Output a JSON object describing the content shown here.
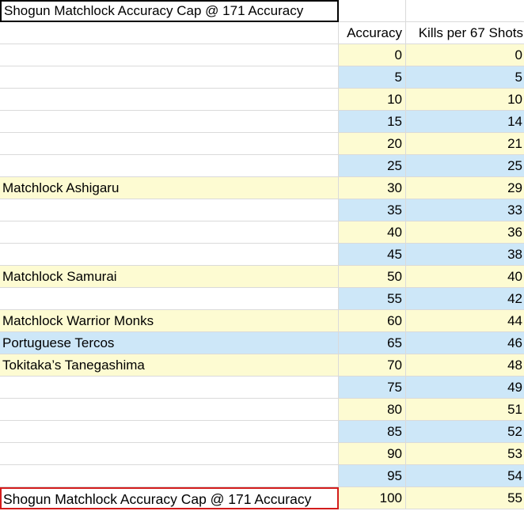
{
  "title": "Shogun Matchlock Accuracy Cap @ 171 Accuracy",
  "headers": {
    "accuracy": "Accuracy",
    "kills": "Kills per 67 Shots"
  },
  "rows": [
    {
      "name": "",
      "accuracy": "0",
      "kills": "0"
    },
    {
      "name": "",
      "accuracy": "5",
      "kills": "5"
    },
    {
      "name": "",
      "accuracy": "10",
      "kills": "10"
    },
    {
      "name": "",
      "accuracy": "15",
      "kills": "14"
    },
    {
      "name": "",
      "accuracy": "20",
      "kills": "21"
    },
    {
      "name": "",
      "accuracy": "25",
      "kills": "25"
    },
    {
      "name": "Matchlock Ashigaru",
      "accuracy": "30",
      "kills": "29"
    },
    {
      "name": "",
      "accuracy": "35",
      "kills": "33"
    },
    {
      "name": "",
      "accuracy": "40",
      "kills": "36"
    },
    {
      "name": "",
      "accuracy": "45",
      "kills": "38"
    },
    {
      "name": "Matchlock Samurai",
      "accuracy": "50",
      "kills": "40"
    },
    {
      "name": "",
      "accuracy": "55",
      "kills": "42"
    },
    {
      "name": "Matchlock Warrior Monks",
      "accuracy": "60",
      "kills": "44"
    },
    {
      "name": "Portuguese Tercos",
      "accuracy": "65",
      "kills": "46"
    },
    {
      "name": "Tokitaka’s Tanegashima",
      "accuracy": "70",
      "kills": "48"
    },
    {
      "name": "",
      "accuracy": "75",
      "kills": "49"
    },
    {
      "name": "",
      "accuracy": "80",
      "kills": "51"
    },
    {
      "name": "",
      "accuracy": "85",
      "kills": "52"
    },
    {
      "name": "",
      "accuracy": "90",
      "kills": "53"
    },
    {
      "name": "",
      "accuracy": "95",
      "kills": "54"
    },
    {
      "name": "Shogun Matchlock Accuracy Cap @ 171 Accuracy",
      "accuracy": "100",
      "kills": "55"
    }
  ],
  "colors": {
    "band_yellow": "#fdfbd2",
    "band_blue": "#cde7f8",
    "cap_border": "#d31c1c"
  }
}
